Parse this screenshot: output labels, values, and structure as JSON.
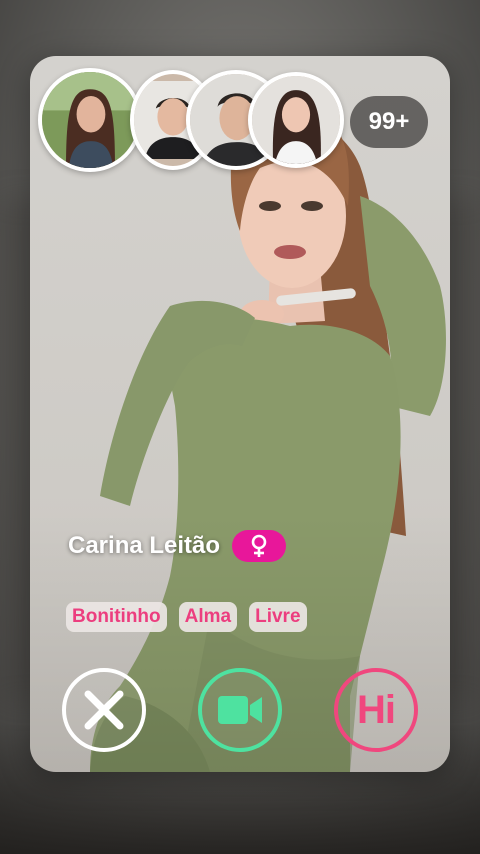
{
  "avatars": [
    {
      "name": "avatar-woman-1"
    },
    {
      "name": "avatar-man-1"
    },
    {
      "name": "avatar-man-2"
    },
    {
      "name": "avatar-woman-2"
    }
  ],
  "count_badge": "99+",
  "profile": {
    "name": "Carina Leitão",
    "gender_icon": "female-symbol-icon"
  },
  "tags": [
    "Bonitinho",
    "Alma",
    "Livre"
  ],
  "actions": {
    "close_icon": "close-x-icon",
    "video_icon": "video-camera-icon",
    "hi_label": "Hi"
  },
  "colors": {
    "accent_pink": "#e8179a",
    "tag_text": "#ec3e7f",
    "video_green": "#4ee2a0",
    "hi_pink": "#f0477e",
    "dress_green": "#8a9a6a"
  }
}
